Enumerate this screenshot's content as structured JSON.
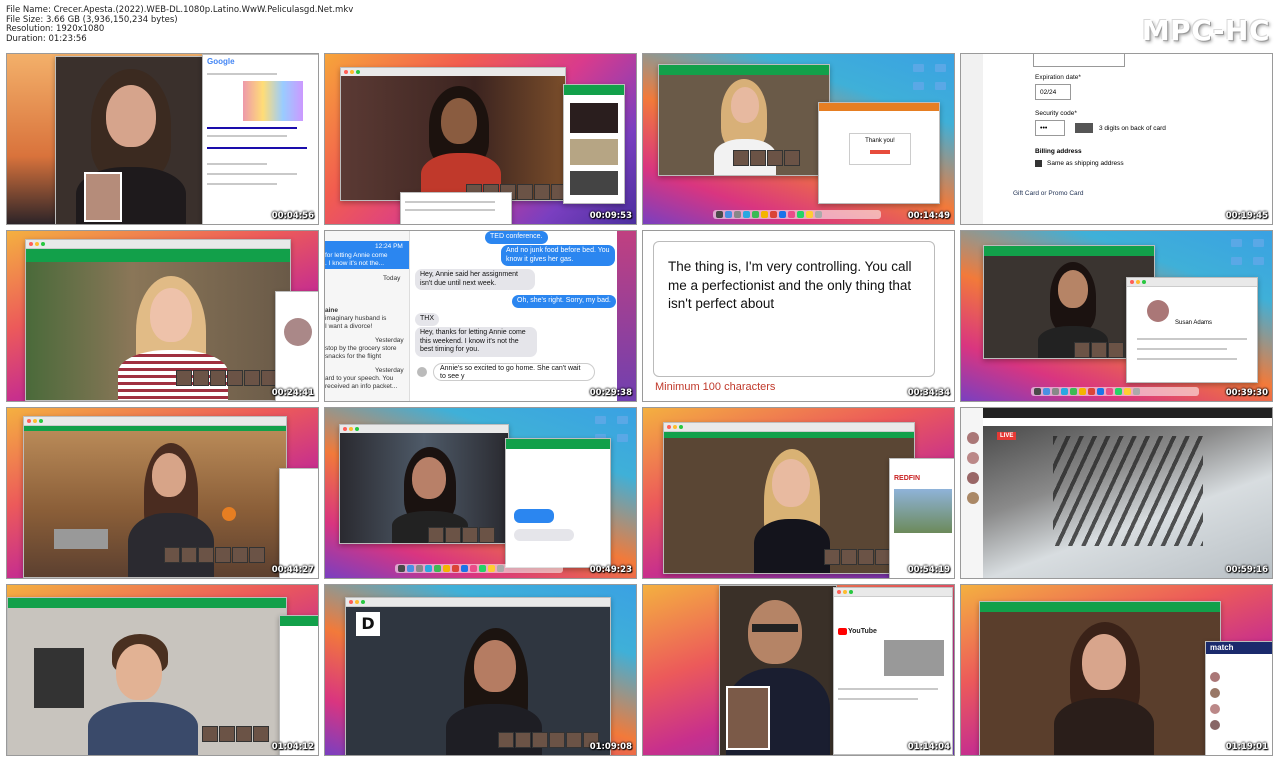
{
  "header": {
    "file_name": "File Name: Crecer.Apesta.(2022).WEB-DL.1080p.Latino.WwW.Peliculasgd.Net.mkv",
    "file_size": "File Size: 3.66 GB (3,936,150,234 bytes)",
    "resolution": "Resolution: 1920x1080",
    "duration": "Duration: 01:23:56"
  },
  "logo": "MPC-HC",
  "thumbs": [
    {
      "time": "00:04:56",
      "google": "Google"
    },
    {
      "time": "00:09:53"
    },
    {
      "time": "00:14:49",
      "dialog": "Thank you!"
    },
    {
      "time": "00:19:45",
      "form": {
        "expiration_label": "Expiration date*",
        "expiration_value": "02/24",
        "security_label": "Security code*",
        "security_value": "•••",
        "security_hint": "3 digits on back of card",
        "billing_label": "Billing address",
        "same_shipping": "Same as shipping address",
        "gift_card": "Gift Card or Promo Card"
      }
    },
    {
      "time": "00:24:41"
    },
    {
      "time": "00:29:38",
      "messages": {
        "sidebar_time": "12:24 PM",
        "sidebar_1": "for letting Annie come",
        "sidebar_2": ". I know it's not the...",
        "sidebar_today": "Today",
        "sidebar_name": "aine",
        "sidebar_3": "imaginary husband is",
        "sidebar_4": "I want a divorce!",
        "sidebar_yesterday": "Yesterday",
        "sidebar_5": "stop by the grocery store",
        "sidebar_6": "snacks for the flight",
        "sidebar_yesterday2": "Yesterday",
        "sidebar_7": "ard to your speech. You",
        "sidebar_8": "received an info packet...",
        "b1": "TED conference.",
        "b2": "And no junk food before bed. You know it gives her gas.",
        "b3": "Hey, Annie said her assignment isn't due until next week.",
        "b4": "Oh, she's right. Sorry, my bad.",
        "b5": "THX",
        "b6": "Hey, thanks for letting Annie come this weekend. I know it's not the best timing for you.",
        "input": "Annie's so excited to go home. She can't wait to see y"
      }
    },
    {
      "time": "00:34:34",
      "essay": "The thing is, I'm very controlling. You call me a perfectionist and the only thing that isn't perfect about",
      "warning": "Minimum 100 characters"
    },
    {
      "time": "00:39:30",
      "profile": "Susan Adams"
    },
    {
      "time": "00:44:27"
    },
    {
      "time": "00:49:23"
    },
    {
      "time": "00:54:19",
      "site": "REDFIN"
    },
    {
      "time": "00:59:16",
      "live": "LIVE"
    },
    {
      "time": "01:04:12"
    },
    {
      "time": "01:09:08"
    },
    {
      "time": "01:14:04",
      "site": "YouTube"
    },
    {
      "time": "01:19:01",
      "site": "match"
    }
  ],
  "colors": {
    "green": "#12a04a",
    "red_warning": "#c0392b"
  }
}
